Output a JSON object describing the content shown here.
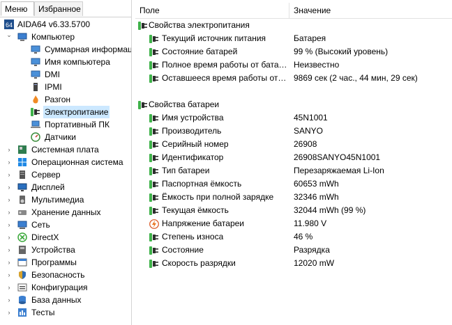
{
  "tabs": {
    "menu": "Меню",
    "favorites": "Избранное"
  },
  "tree": [
    {
      "label": "AIDA64 v6.33.5700",
      "icon": "aida64-badge-icon",
      "level": 0,
      "expander": ""
    },
    {
      "label": "Компьютер",
      "icon": "computer-icon",
      "level": 0,
      "expander": "expanded"
    },
    {
      "label": "Суммарная информация",
      "icon": "monitor-icon",
      "level": 1,
      "expander": ""
    },
    {
      "label": "Имя компьютера",
      "icon": "monitor-icon",
      "level": 1,
      "expander": ""
    },
    {
      "label": "DMI",
      "icon": "monitor-icon",
      "level": 1,
      "expander": ""
    },
    {
      "label": "IPMI",
      "icon": "ipmi-icon",
      "level": 1,
      "expander": ""
    },
    {
      "label": "Разгон",
      "icon": "flame-icon",
      "level": 1,
      "expander": ""
    },
    {
      "label": "Электропитание",
      "icon": "battery-plug-icon",
      "level": 1,
      "expander": "",
      "selected": true
    },
    {
      "label": "Портативный ПК",
      "icon": "laptop-icon",
      "level": 1,
      "expander": ""
    },
    {
      "label": "Датчики",
      "icon": "gauge-icon",
      "level": 1,
      "expander": ""
    },
    {
      "label": "Системная плата",
      "icon": "motherboard-icon",
      "level": 0,
      "expander": "collapsed"
    },
    {
      "label": "Операционная система",
      "icon": "windows-icon",
      "level": 0,
      "expander": "collapsed"
    },
    {
      "label": "Сервер",
      "icon": "server-icon",
      "level": 0,
      "expander": "collapsed"
    },
    {
      "label": "Дисплей",
      "icon": "display-icon",
      "level": 0,
      "expander": "collapsed"
    },
    {
      "label": "Мультимедиа",
      "icon": "speaker-icon",
      "level": 0,
      "expander": "collapsed"
    },
    {
      "label": "Хранение данных",
      "icon": "storage-icon",
      "level": 0,
      "expander": "collapsed"
    },
    {
      "label": "Сеть",
      "icon": "network-icon",
      "level": 0,
      "expander": "collapsed"
    },
    {
      "label": "DirectX",
      "icon": "directx-icon",
      "level": 0,
      "expander": "collapsed"
    },
    {
      "label": "Устройства",
      "icon": "devices-icon",
      "level": 0,
      "expander": "collapsed"
    },
    {
      "label": "Программы",
      "icon": "programs-icon",
      "level": 0,
      "expander": "collapsed"
    },
    {
      "label": "Безопасность",
      "icon": "shield-icon",
      "level": 0,
      "expander": "collapsed"
    },
    {
      "label": "Конфигурация",
      "icon": "config-icon",
      "level": 0,
      "expander": "collapsed"
    },
    {
      "label": "База данных",
      "icon": "database-icon",
      "level": 0,
      "expander": "collapsed"
    },
    {
      "label": "Тесты",
      "icon": "tests-icon",
      "level": 0,
      "expander": "collapsed"
    }
  ],
  "columns": {
    "field": "Поле",
    "value": "Значение"
  },
  "rows": [
    {
      "type": "group",
      "name": "Свойства электропитания",
      "value": "",
      "icon": "plug-icon"
    },
    {
      "type": "item",
      "name": "Текущий источник питания",
      "value": "Батарея",
      "icon": "plug-icon"
    },
    {
      "type": "item",
      "name": "Состояние батарей",
      "value": "99 % (Высокий уровень)",
      "icon": "plug-icon"
    },
    {
      "type": "item",
      "name": "Полное время работы от батареи",
      "value": "Неизвестно",
      "icon": "plug-icon"
    },
    {
      "type": "item",
      "name": "Оставшееся время работы от батареи",
      "value": "9869 сек (2 час., 44 мин, 29 сек)",
      "icon": "plug-icon"
    },
    {
      "type": "blank",
      "name": "",
      "value": "",
      "icon": ""
    },
    {
      "type": "group",
      "name": "Свойства батареи",
      "value": "",
      "icon": "plug-icon"
    },
    {
      "type": "item",
      "name": "Имя устройства",
      "value": "45N1001",
      "icon": "plug-icon"
    },
    {
      "type": "item",
      "name": "Производитель",
      "value": "SANYO",
      "icon": "plug-icon"
    },
    {
      "type": "item",
      "name": "Серийный номер",
      "value": "26908",
      "icon": "plug-icon"
    },
    {
      "type": "item",
      "name": "Идентификатор",
      "value": "26908SANYO45N1001",
      "icon": "plug-icon"
    },
    {
      "type": "item",
      "name": "Тип батареи",
      "value": "Перезаряжаемая Li-Ion",
      "icon": "plug-icon"
    },
    {
      "type": "item",
      "name": "Паспортная ёмкость",
      "value": "60653 mWh",
      "icon": "plug-icon"
    },
    {
      "type": "item",
      "name": "Ёмкость при полной зарядке",
      "value": "32346 mWh",
      "icon": "plug-icon"
    },
    {
      "type": "item",
      "name": "Текущая ёмкость",
      "value": "32044 mWh  (99 %)",
      "icon": "plug-icon"
    },
    {
      "type": "item",
      "name": "Напряжение батареи",
      "value": "11.980 V",
      "icon": "bolt-icon"
    },
    {
      "type": "item",
      "name": "Степень износа",
      "value": "46 %",
      "icon": "plug-icon"
    },
    {
      "type": "item",
      "name": "Состояние",
      "value": "Разрядка",
      "icon": "plug-icon"
    },
    {
      "type": "item",
      "name": "Скорость разрядки",
      "value": "12020 mW",
      "icon": "plug-icon"
    }
  ],
  "colors": {
    "plug_green": "#3fb24a",
    "selection": "#cce8ff",
    "aida_badge": "#1f4e8c"
  }
}
